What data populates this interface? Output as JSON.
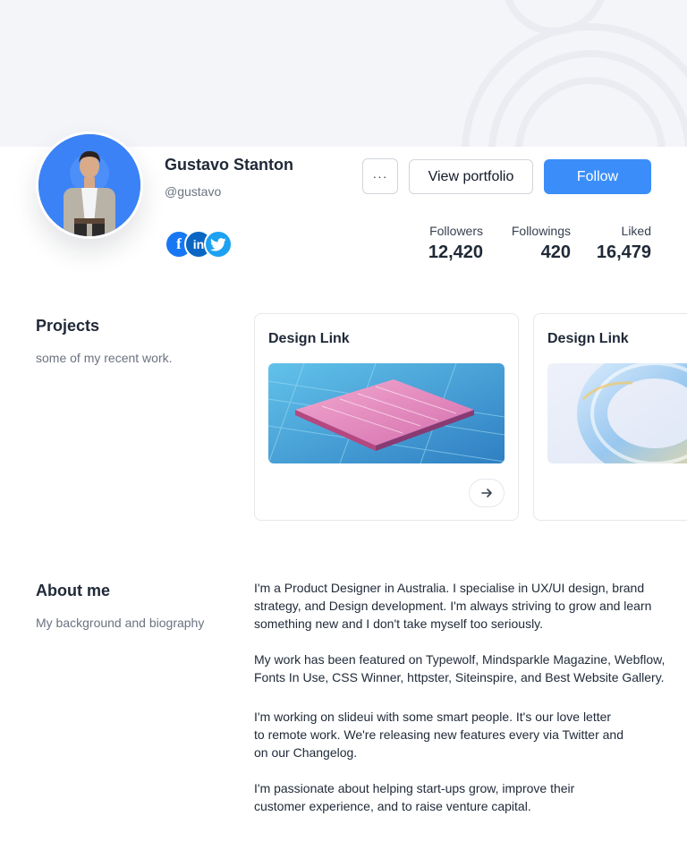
{
  "profile": {
    "name": "Gustavo Stanton",
    "handle": "@gustavo",
    "social": [
      "facebook-icon",
      "linkedin-icon",
      "twitter-icon"
    ]
  },
  "actions": {
    "more_label": "···",
    "portfolio_label": "View portfolio",
    "follow_label": "Follow"
  },
  "stats": [
    {
      "label": "Followers",
      "value": "12,420"
    },
    {
      "label": "Followings",
      "value": "420"
    },
    {
      "label": "Liked",
      "value": "16,479"
    }
  ],
  "projects": {
    "title": "Projects",
    "subtitle": "some of my recent work.",
    "cards": [
      {
        "title": "Design Link",
        "image": "circuit-board-render"
      },
      {
        "title": "Design Link",
        "image": "glass-torus-render"
      }
    ]
  },
  "about": {
    "title": "About me",
    "subtitle": "My background and biography",
    "paragraphs": [
      "I'm a Product Designer in Australia. I specialise in UX/UI design, brand\nstrategy, and Design development. I'm always striving to grow and learn\nsomething new and I don't take myself too seriously.",
      "My work has been featured on Typewolf, Mindsparkle Magazine, Webflow,\nFonts In Use, CSS Winner, httpster, Siteinspire, and Best Website Gallery.",
      "I'm working on slideui with some smart people. It's our love letter\nto remote work. We're releasing new features every via Twitter and\non our Changelog.",
      "I'm passionate about helping start-ups grow, improve their\ncustomer experience, and to raise venture capital."
    ]
  },
  "colors": {
    "accent": "#3b8ef9",
    "avatar_bg": "#3b82f6",
    "cover_bg": "#f4f5f8"
  }
}
